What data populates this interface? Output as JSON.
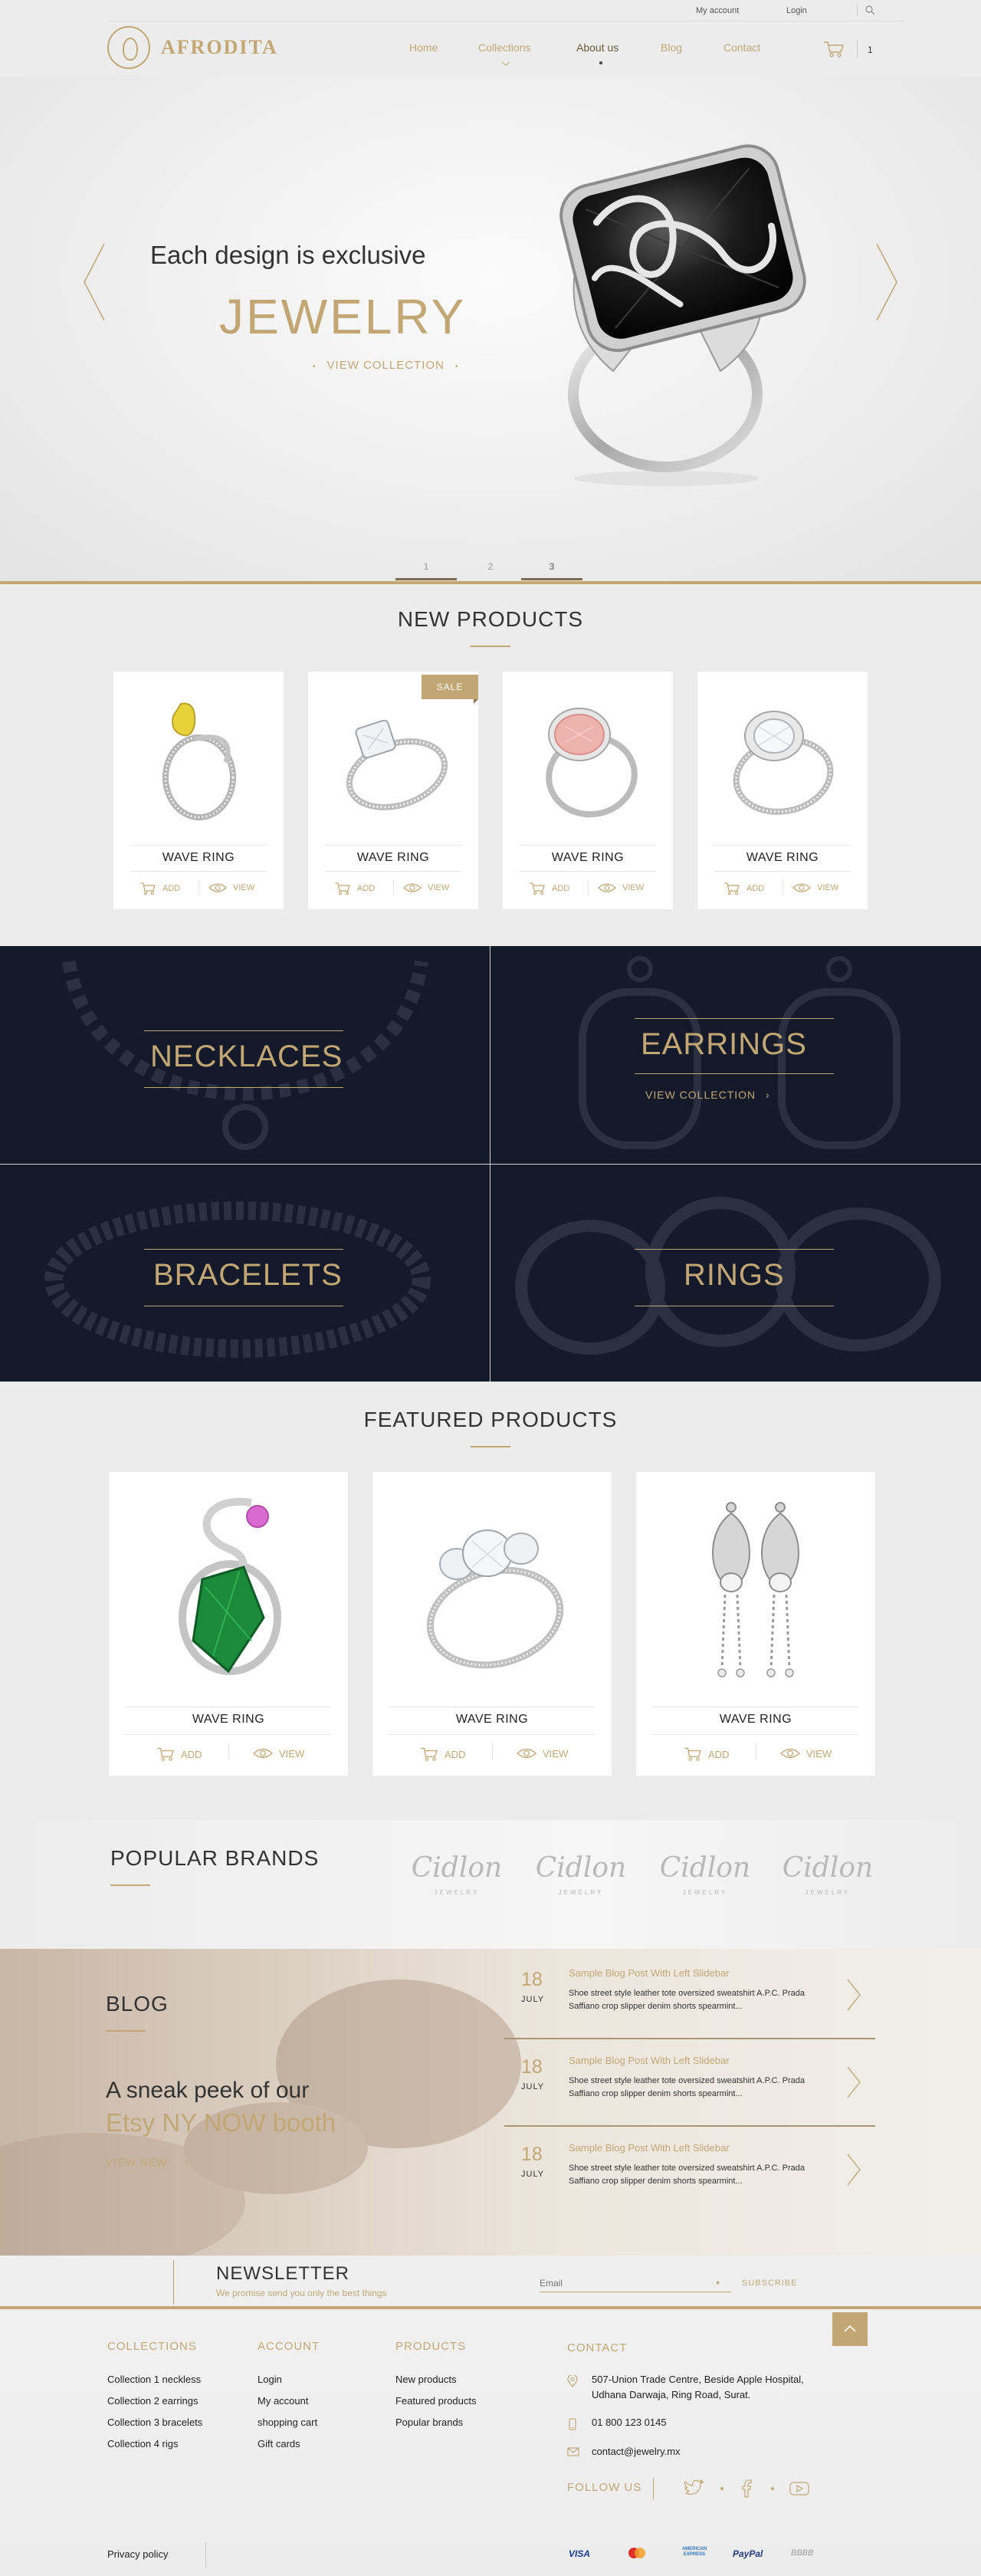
{
  "topbar": {
    "my_account": "My account",
    "login": "Login",
    "search_icon": "search-icon"
  },
  "brand": {
    "name": "AFRODITA"
  },
  "nav": {
    "items": [
      "Home",
      "Collections",
      "About us",
      "Blog",
      "Contact"
    ],
    "active": "About us"
  },
  "cart": {
    "icon": "cart-icon",
    "count": "1"
  },
  "hero": {
    "tagline": "Each design is exclusive",
    "title": "JEWELRY",
    "link": "VIEW COLLECTION",
    "pager": [
      "1",
      "2",
      "3"
    ]
  },
  "new_products": {
    "title": "NEW PRODUCTS",
    "sale_label": "SALE",
    "items": [
      {
        "name": "WAVE RING",
        "add": "ADD",
        "view": "VIEW"
      },
      {
        "name": "WAVE RING",
        "add": "ADD",
        "view": "VIEW"
      },
      {
        "name": "WAVE RING",
        "add": "ADD",
        "view": "VIEW"
      },
      {
        "name": "WAVE RING",
        "add": "ADD",
        "view": "VIEW"
      }
    ]
  },
  "categories": {
    "items": [
      {
        "label": "NECKLACES"
      },
      {
        "label": "EARRINGS",
        "link": "VIEW COLLECTION"
      },
      {
        "label": "BRACELETS"
      },
      {
        "label": "RINGS"
      }
    ]
  },
  "featured": {
    "title": "FEATURED PRODUCTS",
    "items": [
      {
        "name": "WAVE RING",
        "add": "ADD",
        "view": "VIEW"
      },
      {
        "name": "WAVE RING",
        "add": "ADD",
        "view": "VIEW"
      },
      {
        "name": "WAVE RING",
        "add": "ADD",
        "view": "VIEW"
      }
    ]
  },
  "brands": {
    "title": "POPULAR BRANDS",
    "logo_text": "Cidlon",
    "logo_sub": "JEWELRY"
  },
  "blog": {
    "title": "BLOG",
    "headline_1": "A sneak peek of our",
    "headline_2": "Etsy NY NOW booth",
    "view": "VIEW NEW",
    "posts": [
      {
        "day": "18",
        "month": "JULY",
        "title": "Sample Blog Post With Left Slidebar",
        "text": "Shoe street style leather tote oversized sweatshirt A.P.C. Prada Saffiano crop slipper denim shorts spearmint..."
      },
      {
        "day": "18",
        "month": "JULY",
        "title": "Sample Blog Post With Left Slidebar",
        "text": "Shoe street style leather tote oversized sweatshirt A.P.C. Prada Saffiano crop slipper denim shorts spearmint..."
      },
      {
        "day": "18",
        "month": "JULY",
        "title": "Sample Blog Post With Left Slidebar",
        "text": "Shoe street style leather tote oversized sweatshirt A.P.C. Prada Saffiano crop slipper denim shorts spearmint..."
      }
    ]
  },
  "newsletter": {
    "title": "NEWSLETTER",
    "subtitle": "We promise send you only the best things",
    "email_placeholder": "Email",
    "subscribe": "SUBSCRIBE"
  },
  "footer": {
    "collections": {
      "title": "COLLECTIONS",
      "items": [
        "Collection 1 neckless",
        "Collection 2 earrings",
        "Collection 3 bracelets",
        "Collection 4 rigs"
      ]
    },
    "account": {
      "title": "ACCOUNT",
      "items": [
        "Login",
        "My account",
        "shopping cart",
        "Gift cards"
      ]
    },
    "products": {
      "title": "PRODUCTS",
      "items": [
        "New products",
        "Featured products",
        "Popular brands"
      ]
    },
    "contact": {
      "title": "CONTACT",
      "address": "507-Union Trade Centre, Beside Apple Hospital, Udhana Darwaja, Ring Road, Surat.",
      "phone": "01 800 123 0145",
      "email": "contact@jewelry.mx"
    },
    "follow_us": "FOLLOW US",
    "privacy": "Privacy policy",
    "payments": [
      "VISA",
      "mastercard",
      "AMERICAN EXPRESS",
      "PayPal",
      "BBBB"
    ]
  },
  "colors": {
    "accent_gold": "#c2a775",
    "navy": "#151a2b",
    "background": "#ececec"
  }
}
